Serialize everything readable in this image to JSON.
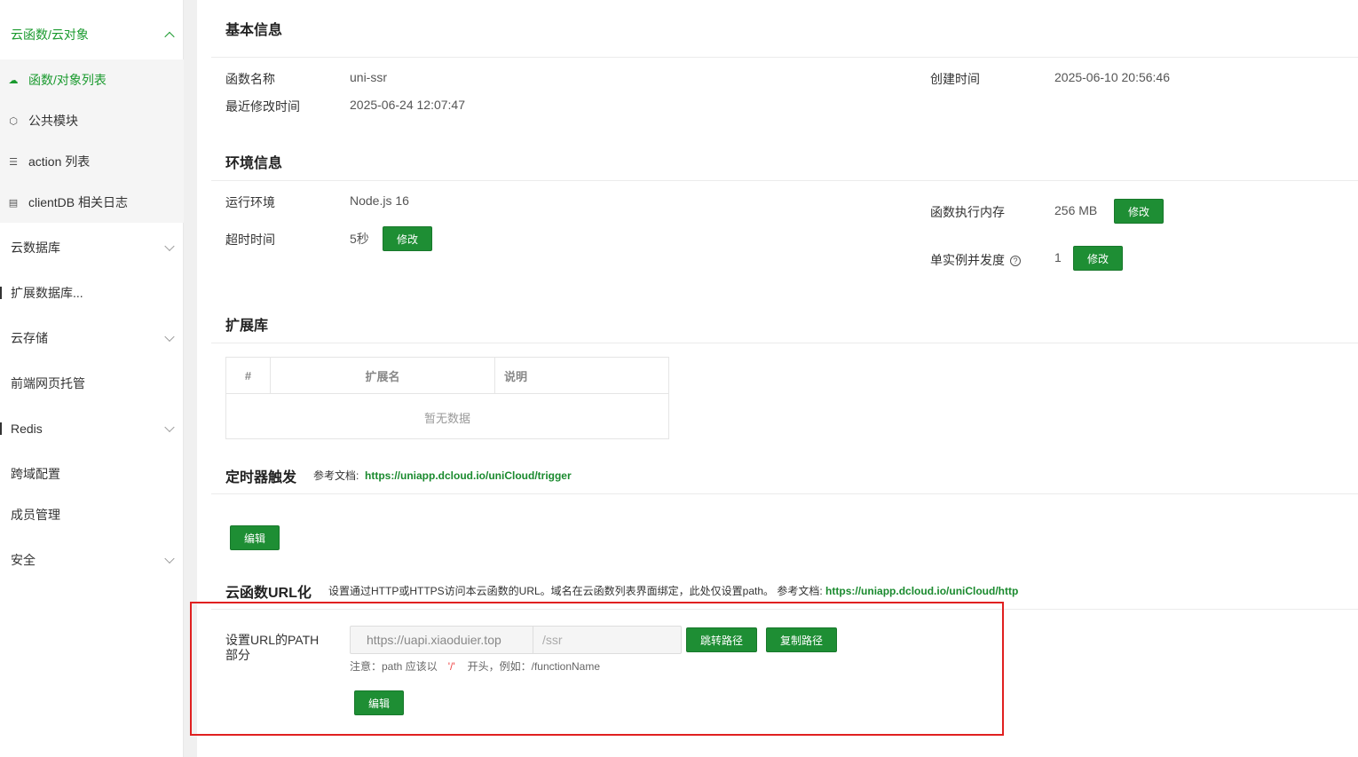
{
  "sidebar": {
    "group_open": "云函数/云对象",
    "sub_items": [
      {
        "icon": "cloud-icon",
        "glyph": "☁",
        "label": "函数/对象列表",
        "active": true
      },
      {
        "icon": "cube-icon",
        "glyph": "⬡",
        "label": "公共模块"
      },
      {
        "icon": "list-icon",
        "glyph": "☰",
        "label": "action 列表"
      },
      {
        "icon": "log-icon",
        "glyph": "▤",
        "label": "clientDB 相关日志"
      }
    ],
    "items": [
      {
        "label": "云数据库",
        "expandable": true
      },
      {
        "label": "扩展数据库..."
      },
      {
        "label": "云存储",
        "expandable": true
      },
      {
        "label": "前端网页托管"
      },
      {
        "label": "Redis",
        "expandable": true
      },
      {
        "label": "跨域配置"
      },
      {
        "label": "成员管理"
      },
      {
        "label": "安全",
        "expandable": true
      }
    ]
  },
  "basic": {
    "title": "基本信息",
    "fn_name_label": "函数名称",
    "fn_name": "uni-ssr",
    "modified_label": "最近修改时间",
    "modified": "2025-06-24 12:07:47",
    "created_label": "创建时间",
    "created": "2025-06-10 20:56:46"
  },
  "env": {
    "title": "环境信息",
    "runtime_label": "运行环境",
    "runtime": "Node.js 16",
    "timeout_label": "超时时间",
    "timeout": "5秒",
    "memory_label": "函数执行内存",
    "memory": "256 MB",
    "concurrency_label": "单实例并发度",
    "concurrency": "1",
    "edit_label": "修改"
  },
  "ext": {
    "title": "扩展库",
    "col_index": "#",
    "col_name": "扩展名",
    "col_desc": "说明",
    "empty": "暂无数据"
  },
  "trigger": {
    "title": "定时器触发",
    "doc_prefix": "参考文档:",
    "doc_link": "https://uniapp.dcloud.io/uniCloud/trigger",
    "edit_label": "编辑"
  },
  "url": {
    "title": "云函数URL化",
    "desc": "设置通过HTTP或HTTPS访问本云函数的URL。域名在云函数列表界面绑定，此处仅设置path。 参考文档:",
    "doc_link": "https://uniapp.dcloud.io/uniCloud/http",
    "path_label_1": "设置URL的PATH",
    "path_label_2": "部分",
    "domain": "https://uapi.xiaoduier.top",
    "path": "/ssr",
    "jump_label": "跳转路径",
    "copy_label": "复制路径",
    "hint_prefix": "注意：path 应该以",
    "hint_slash": "'/'",
    "hint_suffix": "开头，例如：/functionName",
    "edit_label": "编辑"
  }
}
